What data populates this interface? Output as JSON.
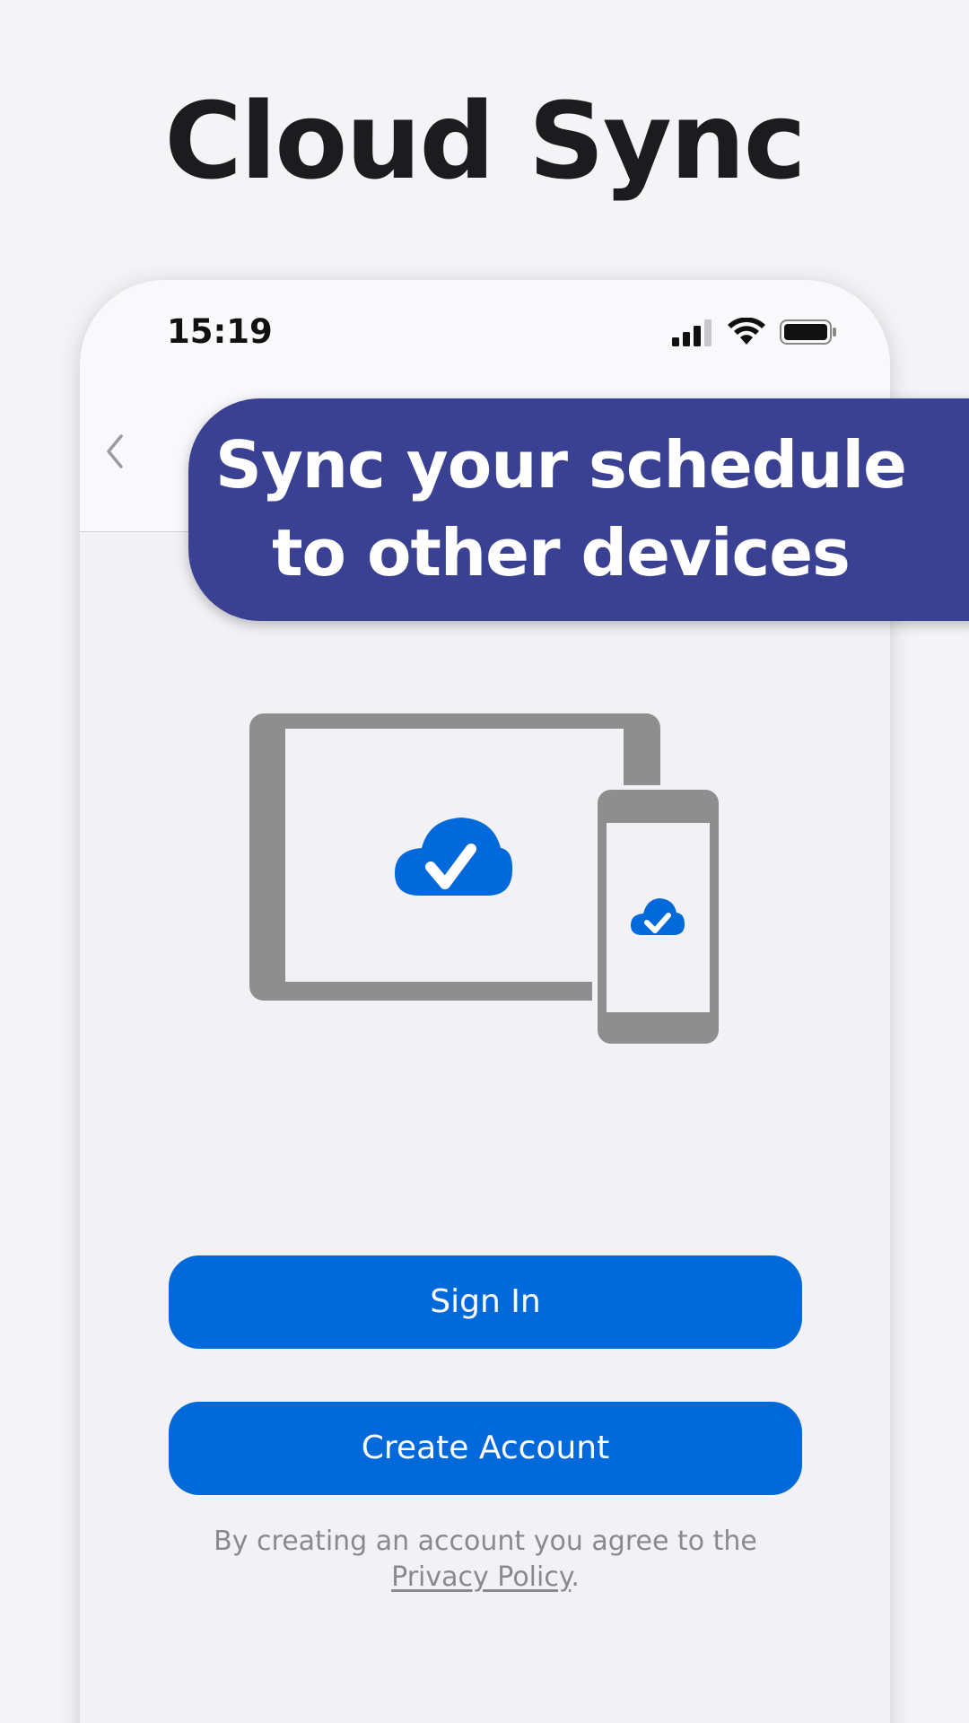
{
  "screen": {
    "headline": "Cloud Sync",
    "status_bar": {
      "time": "15:19",
      "icons": [
        "cellular-signal-icon",
        "wifi-icon",
        "battery-icon"
      ]
    },
    "nav": {
      "back_icon": "chevron-left-icon"
    },
    "banner": {
      "line1": "Sync your schedule",
      "line2": "to other devices"
    },
    "illustration": {
      "icons": [
        "tablet-icon",
        "phone-icon",
        "cloud-check-icon"
      ]
    },
    "buttons": {
      "sign_in": "Sign In",
      "create_account": "Create Account"
    },
    "legal": {
      "text": "By creating an account you agree to the",
      "link": "Privacy Policy",
      "suffix": "."
    }
  },
  "colors": {
    "background": "#f4f4f6",
    "banner": "#3a4193",
    "primary_button": "#0269db",
    "device_gray": "#8e8e8e"
  }
}
